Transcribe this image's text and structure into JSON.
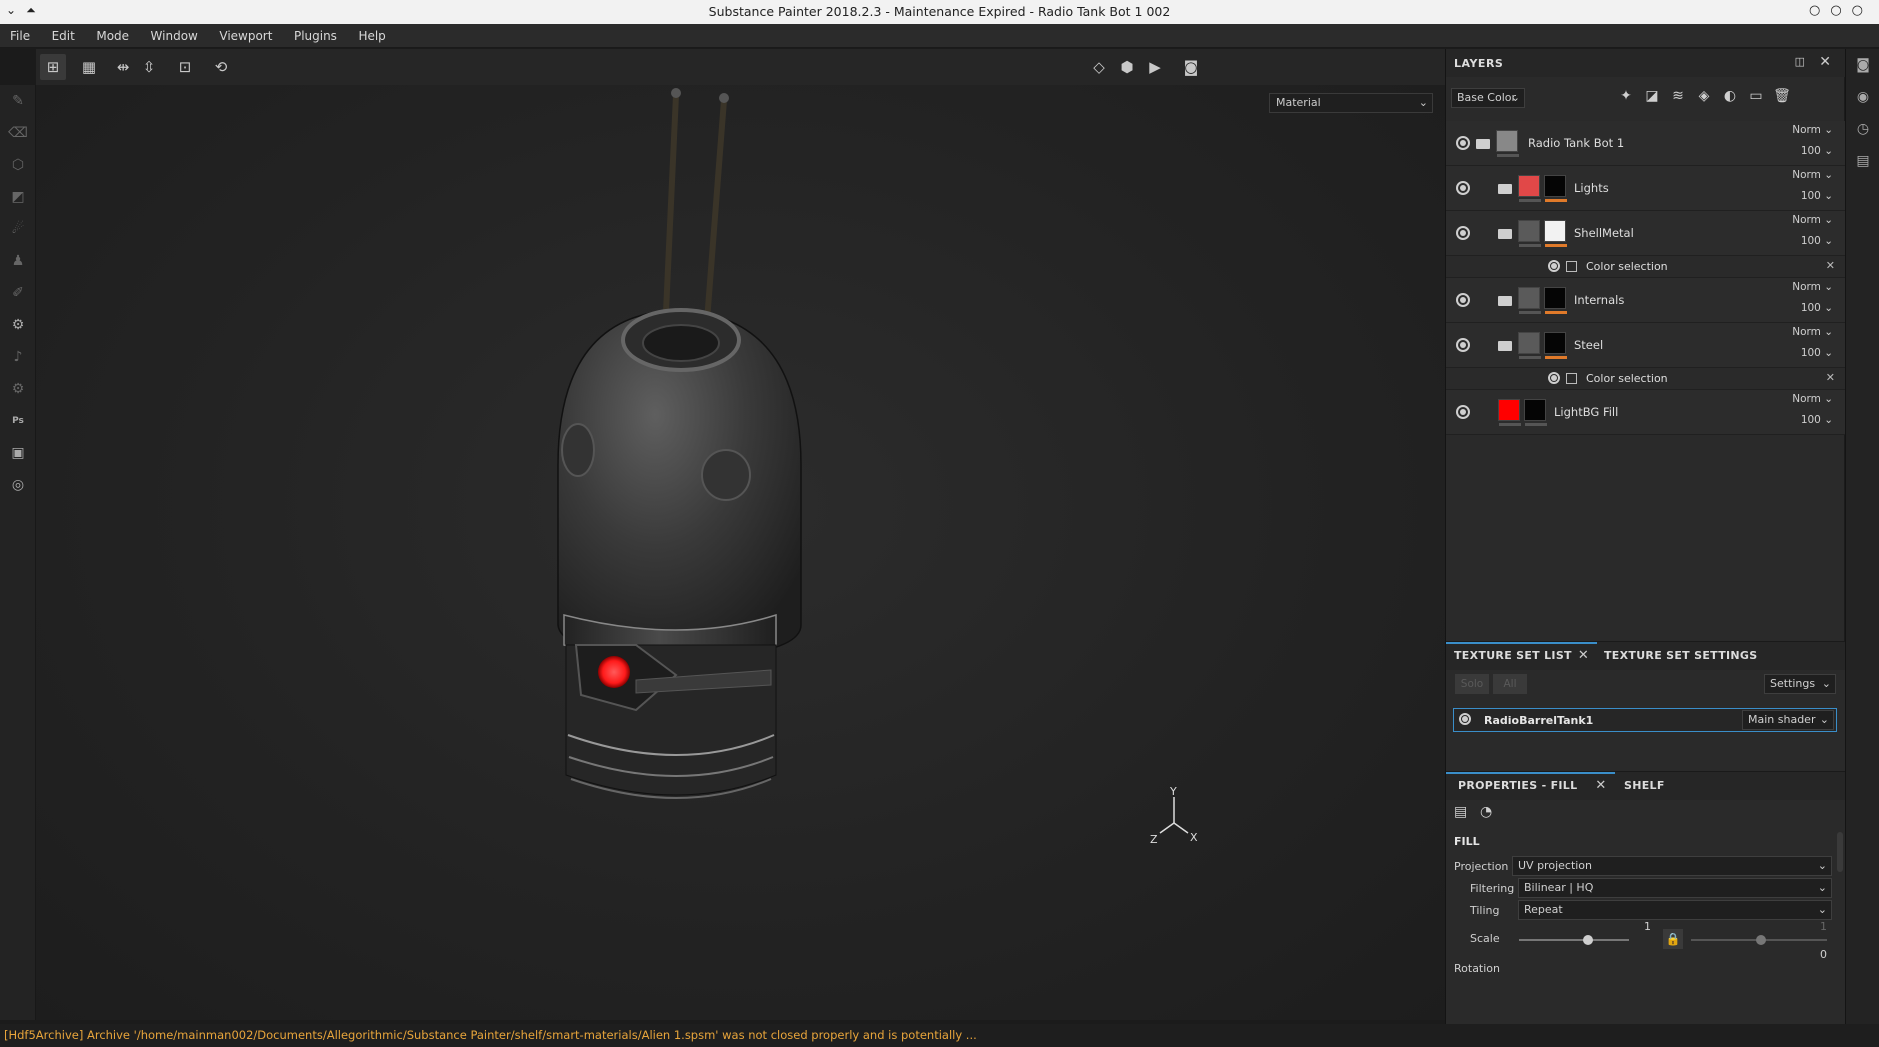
{
  "window": {
    "title": "Substance Painter 2018.2.3 - Maintenance Expired - Radio Tank Bot 1 002",
    "left_controls": [
      "⌄",
      "⏶"
    ],
    "right_controls": [
      "○",
      "○",
      "○"
    ]
  },
  "menu": [
    "File",
    "Edit",
    "Mode",
    "Window",
    "Viewport",
    "Plugins",
    "Help"
  ],
  "viewport": {
    "material_select": "Material",
    "axis_labels": {
      "y": "Y",
      "x": "X",
      "z": "Z"
    }
  },
  "layers": {
    "title": "LAYERS",
    "channel_select": "Base Color",
    "items": [
      {
        "name": "Radio Tank Bot 1",
        "blend": "Norm",
        "opacity": "100",
        "swatch": "#5a5a5a",
        "mask": "#888888"
      },
      {
        "name": "Lights",
        "blend": "Norm",
        "opacity": "100",
        "swatch": "#e14848",
        "mask": "#050505"
      },
      {
        "name": "ShellMetal",
        "blend": "Norm",
        "opacity": "100",
        "swatch": "#5a5a5a",
        "mask": "#f2f2f2",
        "effect": "Color selection"
      },
      {
        "name": "Internals",
        "blend": "Norm",
        "opacity": "100",
        "swatch": "#5a5a5a",
        "mask": "#050505"
      },
      {
        "name": "Steel",
        "blend": "Norm",
        "opacity": "100",
        "swatch": "#5a5a5a",
        "mask": "#050505",
        "effect": "Color selection"
      },
      {
        "name": "LightBG Fill",
        "blend": "Norm",
        "opacity": "100",
        "swatch": "#ff0000",
        "mask": "#050505"
      }
    ]
  },
  "texture_set": {
    "tab_list": "TEXTURE SET LIST",
    "tab_settings": "TEXTURE SET SETTINGS",
    "solo": "Solo",
    "all": "All",
    "settings": "Settings",
    "set_name": "RadioBarrelTank1",
    "shader": "Main shader"
  },
  "properties": {
    "tab_fill": "PROPERTIES - FILL",
    "tab_shelf": "SHELF",
    "section": "FILL",
    "projection_label": "Projection",
    "projection_value": "UV projection",
    "filtering_label": "Filtering",
    "filtering_value": "Bilinear | HQ",
    "tiling_label": "Tiling",
    "tiling_value": "Repeat",
    "scale_label": "Scale",
    "scale_value": "1",
    "scale_value_2": "1",
    "offset_value": "0",
    "rotation_label": "Rotation"
  },
  "status": "[Hdf5Archive] Archive '/home/mainman002/Documents/Allegorithmic/Substance Painter/shelf/smart-materials/Alien 1.spsm' was not closed properly and is potentially ...",
  "colors": {
    "accent": "#3a8ec9",
    "status_text": "#e8a53b",
    "light_red": "#ff2a2a"
  }
}
